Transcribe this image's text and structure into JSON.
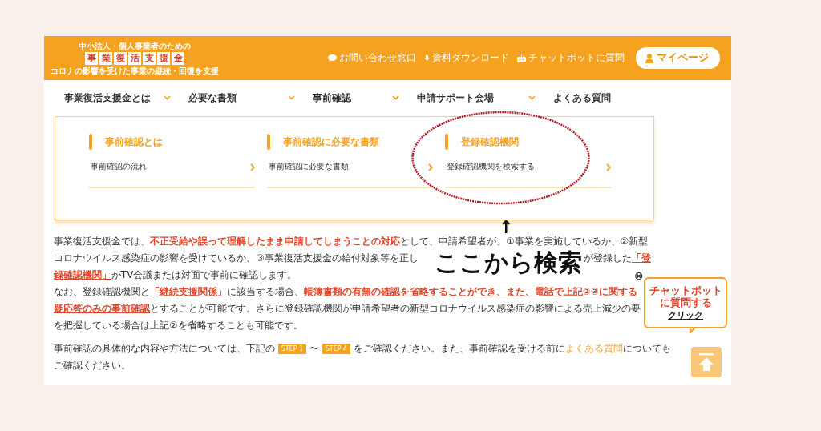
{
  "logo": {
    "tagline_top": "中小法人・個人事業者のための",
    "title": "事業復活支援金",
    "tagline_bottom": "コロナの影響を受けた事業の継続・回復を支援"
  },
  "header_links": [
    {
      "label": "お問い合わせ窓口",
      "kind": "chat"
    },
    {
      "label": "資料ダウンロード",
      "kind": "download"
    },
    {
      "label": "チャットボットに質問",
      "kind": "robot"
    }
  ],
  "mypage_button": "マイページ",
  "nav": [
    {
      "label": "事業復活支援金とは",
      "expanded": false,
      "has_dropdown": true
    },
    {
      "label": "必要な書類",
      "expanded": false,
      "has_dropdown": true
    },
    {
      "label": "事前確認",
      "expanded": true,
      "has_dropdown": true
    },
    {
      "label": "申請サポート会場",
      "expanded": false,
      "has_dropdown": true
    },
    {
      "label": "よくある質問",
      "expanded": false,
      "has_dropdown": false
    }
  ],
  "dropdown": [
    {
      "heading": "事前確認とは",
      "link": "事前確認の流れ"
    },
    {
      "heading": "事前確認に必要な書類",
      "link": "事前確認に必要な書類"
    },
    {
      "heading": "登録確認機関",
      "link": "登録確認機関を検索する"
    }
  ],
  "paragraphs": [
    {
      "lines": [
        [
          {
            "kind": "plain",
            "text": "事業復活支援金では、"
          },
          {
            "kind": "strong",
            "text": "不正受給や誤って理解したまま申請してしまうことの対応"
          },
          {
            "kind": "plain",
            "text": "として、申請希望者が、①事業を実施しているか、②新型"
          }
        ],
        [
          {
            "kind": "plain",
            "text": "コロナウイルス感染症の影響を受けているか、③事業復活支援金の給付対象等を正し"
          },
          {
            "kind": "gap"
          },
          {
            "kind": "plain",
            "text": "が登録した"
          },
          {
            "kind": "link",
            "text": "「登"
          }
        ],
        [
          {
            "kind": "link",
            "text": "録確認機関」"
          },
          {
            "kind": "plain",
            "text": "がTV会議または対面で事前に確認します。"
          }
        ],
        [
          {
            "kind": "plain",
            "text": "なお、登録確認機関と"
          },
          {
            "kind": "link",
            "text": "「継続支援関係」"
          },
          {
            "kind": "plain",
            "text": "に該当する場合、"
          },
          {
            "kind": "link",
            "text": "帳簿書類の有無の確認を省略することができ、また、電話で上記②③に関する"
          }
        ],
        [
          {
            "kind": "link",
            "text": "疑応答のみの事前確認"
          },
          {
            "kind": "plain",
            "text": "とすることが可能です。さらに登録確認機関が申請希望者の新型コロナウイルス感染症の影響による売上減少の要"
          }
        ],
        [
          {
            "kind": "plain",
            "text": "を把握している場合は上記②を省略することも可能です。"
          }
        ]
      ]
    },
    {
      "lines": [
        [
          {
            "kind": "plain",
            "text": "事前確認の具体的な内容や方法については、下記の "
          },
          {
            "kind": "step",
            "text": "STEP 1"
          },
          {
            "kind": "plain",
            "text": " 〜 "
          },
          {
            "kind": "step",
            "text": "STEP 4"
          },
          {
            "kind": "plain",
            "text": " をご確認ください。また、事前確認を受ける前に"
          },
          {
            "kind": "faq",
            "text": "よくある質問"
          },
          {
            "kind": "plain",
            "text": "についても"
          }
        ],
        [
          {
            "kind": "plain",
            "text": "ご確認ください。"
          }
        ]
      ]
    }
  ],
  "annotation": {
    "arrow": "↑",
    "label": "ここから検索"
  },
  "chat_bubble": {
    "close": "⊗",
    "lines": [
      "チャットボット",
      "に質問する"
    ],
    "action": "クリック"
  }
}
